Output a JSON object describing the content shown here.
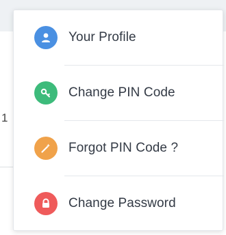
{
  "background": {
    "fragment_text": "1"
  },
  "menu": {
    "items": [
      {
        "label": "Your Profile",
        "icon": "user-icon",
        "color": "#4a90e2"
      },
      {
        "label": "Change PIN Code",
        "icon": "key-icon",
        "color": "#3dbb7b"
      },
      {
        "label": "Forgot PIN Code ?",
        "icon": "magic-wand-icon",
        "color": "#f0a24a"
      },
      {
        "label": "Change Password",
        "icon": "lock-icon",
        "color": "#ef5b5b"
      }
    ]
  }
}
